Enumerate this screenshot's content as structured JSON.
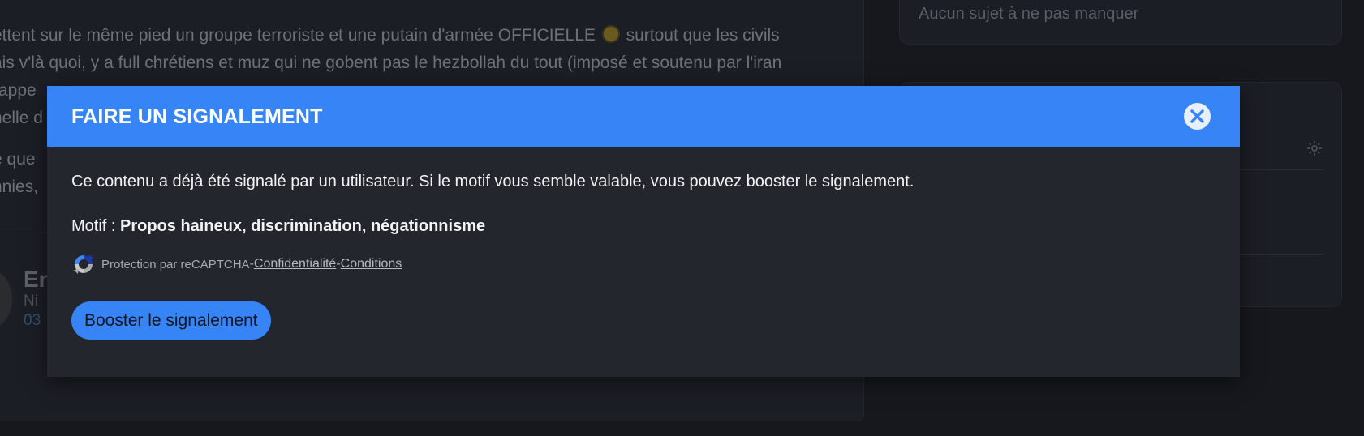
{
  "background": {
    "post_lines": [
      "ettent sur le même pied un groupe terroriste et une putain d'armée OFFICIELLE",
      "surtout que les civils",
      "ais v'là quoi, y a full chrétiens et muz qui ne gobent pas le hezbollah du tout (imposé et soutenu par l'iran",
      "rappe",
      "nelle d",
      "e que",
      "nnies,"
    ],
    "author": {
      "name": "En",
      "sub": "Ni",
      "date": "03"
    },
    "sidebar": {
      "topics_empty": "Aucun sujet à ne pas manquer",
      "settings_icon": "gear-icon"
    }
  },
  "modal": {
    "title": "FAIRE UN SIGNALEMENT",
    "close_icon": "close-icon",
    "info": "Ce contenu a déjà été signalé par un utilisateur. Si le motif vous semble valable, vous pouvez booster le signalement.",
    "motif_label": "Motif : ",
    "motif_value": "Propos haineux, discrimination, négationnisme",
    "recaptcha": {
      "prefix": "Protection par reCAPTCHA",
      "sep": " - ",
      "privacy": "Confidentialité",
      "terms": "Conditions"
    },
    "boost_button": "Booster le signalement"
  },
  "colors": {
    "accent": "#3784f7",
    "modal_bg": "#23262d",
    "page_bg": "#16181d"
  }
}
